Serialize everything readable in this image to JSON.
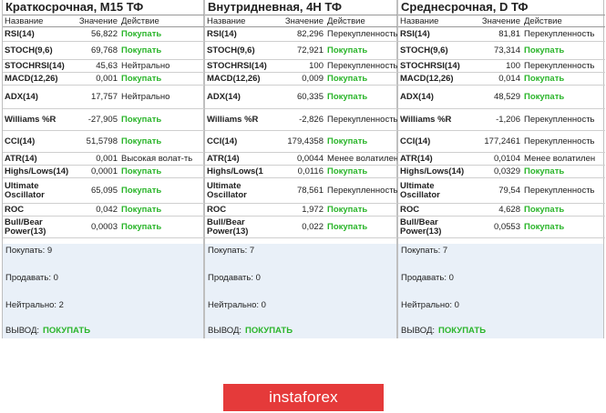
{
  "columns": {
    "name": "Название",
    "value": "Значение",
    "action": "Действие"
  },
  "panels": [
    {
      "title": "Краткосрочная, М15 ТФ",
      "rows": [
        {
          "name": "RSI(14)",
          "value": "56,822",
          "action": "Покупать",
          "type": "buy"
        },
        {
          "name": "STOCH(9,6)",
          "value": "69,768",
          "action": "Покупать",
          "type": "buy"
        },
        {
          "name": "STOCHRSI(14)",
          "value": "45,63",
          "action": "Нейтрально",
          "type": "neutral"
        },
        {
          "name": "MACD(12,26)",
          "value": "0,001",
          "action": "Покупать",
          "type": "buy"
        },
        {
          "name": "ADX(14)",
          "value": "17,757",
          "action": "Нейтрально",
          "type": "neutral"
        },
        {
          "name": "Williams %R",
          "value": "-27,905",
          "action": "Покупать",
          "type": "buy"
        },
        {
          "name": "CCI(14)",
          "value": "51,5798",
          "action": "Покупать",
          "type": "buy"
        },
        {
          "name": "ATR(14)",
          "value": "0,001",
          "action": "Высокая волат-ть",
          "type": "neutral"
        },
        {
          "name": "Highs/Lows(14)",
          "value": "0,0001",
          "action": "Покупать",
          "type": "buy"
        },
        {
          "name": "Ultimate Oscillator",
          "value": "65,095",
          "action": "Покупать",
          "type": "buy"
        },
        {
          "name": "ROC",
          "value": "0,042",
          "action": "Покупать",
          "type": "buy"
        },
        {
          "name": "Bull/Bear Power(13)",
          "value": "0,0003",
          "action": "Покупать",
          "type": "buy"
        }
      ],
      "summary": {
        "buy": "Покупать: 9",
        "sell": "Продавать: 0",
        "neutral": "Нейтрально: 2",
        "verdict_label": "ВЫВОД:",
        "verdict": "ПОКУПАТЬ"
      }
    },
    {
      "title": "Внутридневная, 4Н ТФ",
      "rows": [
        {
          "name": "RSI(14)",
          "value": "82,296",
          "action": "Перекупленность",
          "type": "neutral"
        },
        {
          "name": "STOCH(9,6)",
          "value": "72,921",
          "action": "Покупать",
          "type": "buy"
        },
        {
          "name": "STOCHRSI(14)",
          "value": "100",
          "action": "Перекупленность",
          "type": "neutral"
        },
        {
          "name": "MACD(12,26)",
          "value": "0,009",
          "action": "Покупать",
          "type": "buy"
        },
        {
          "name": "ADX(14)",
          "value": "60,335",
          "action": "Покупать",
          "type": "buy"
        },
        {
          "name": "Williams %R",
          "value": "-2,826",
          "action": "Перекупленность",
          "type": "neutral"
        },
        {
          "name": "CCI(14)",
          "value": "179,4358",
          "action": "Покупать",
          "type": "buy"
        },
        {
          "name": "ATR(14)",
          "value": "0,0044",
          "action": "Менее волатилен",
          "type": "neutral"
        },
        {
          "name": "Highs/Lows(1",
          "value": "0,0116",
          "action": "Покупать",
          "type": "buy"
        },
        {
          "name": "Ultimate Oscillator",
          "value": "78,561",
          "action": "Перекупленность",
          "type": "neutral"
        },
        {
          "name": "ROC",
          "value": "1,972",
          "action": "Покупать",
          "type": "buy"
        },
        {
          "name": "Bull/Bear Power(13)",
          "value": "0,022",
          "action": "Покупать",
          "type": "buy"
        }
      ],
      "summary": {
        "buy": "Покупать: 7",
        "sell": "Продавать: 0",
        "neutral": "Нейтрально: 0",
        "verdict_label": "ВЫВОД:",
        "verdict": "ПОКУПАТЬ"
      }
    },
    {
      "title": "Среднесрочная, D ТФ",
      "rows": [
        {
          "name": "RSI(14)",
          "value": "81,81",
          "action": "Перекупленность",
          "type": "neutral"
        },
        {
          "name": "STOCH(9,6)",
          "value": "73,314",
          "action": "Покупать",
          "type": "buy"
        },
        {
          "name": "STOCHRSI(14)",
          "value": "100",
          "action": "Перекупленность",
          "type": "neutral"
        },
        {
          "name": "MACD(12,26)",
          "value": "0,014",
          "action": "Покупать",
          "type": "buy"
        },
        {
          "name": "ADX(14)",
          "value": "48,529",
          "action": "Покупать",
          "type": "buy"
        },
        {
          "name": "Williams %R",
          "value": "-1,206",
          "action": "Перекупленность",
          "type": "neutral"
        },
        {
          "name": "CCI(14)",
          "value": "177,2461",
          "action": "Перекупленность",
          "type": "neutral"
        },
        {
          "name": "ATR(14)",
          "value": "0,0104",
          "action": "Менее волатилен",
          "type": "neutral"
        },
        {
          "name": "Highs/Lows(14)",
          "value": "0,0329",
          "action": "Покупать",
          "type": "buy"
        },
        {
          "name": "Ultimate Oscillator",
          "value": "79,54",
          "action": "Перекупленность",
          "type": "neutral"
        },
        {
          "name": "ROC",
          "value": "4,628",
          "action": "Покупать",
          "type": "buy"
        },
        {
          "name": "Bull/Bear Power(13)",
          "value": "0,0553",
          "action": "Покупать",
          "type": "buy"
        }
      ],
      "summary": {
        "buy": "Покупать: 7",
        "sell": "Продавать: 0",
        "neutral": "Нейтрально: 0",
        "verdict_label": "ВЫВОД:",
        "verdict": "ПОКУПАТЬ"
      }
    }
  ],
  "brand": {
    "label": "instaforex",
    "color": "#e53a3a"
  },
  "colors": {
    "buy": "#2bb52b",
    "summary_bg": "#e9f0f8"
  }
}
